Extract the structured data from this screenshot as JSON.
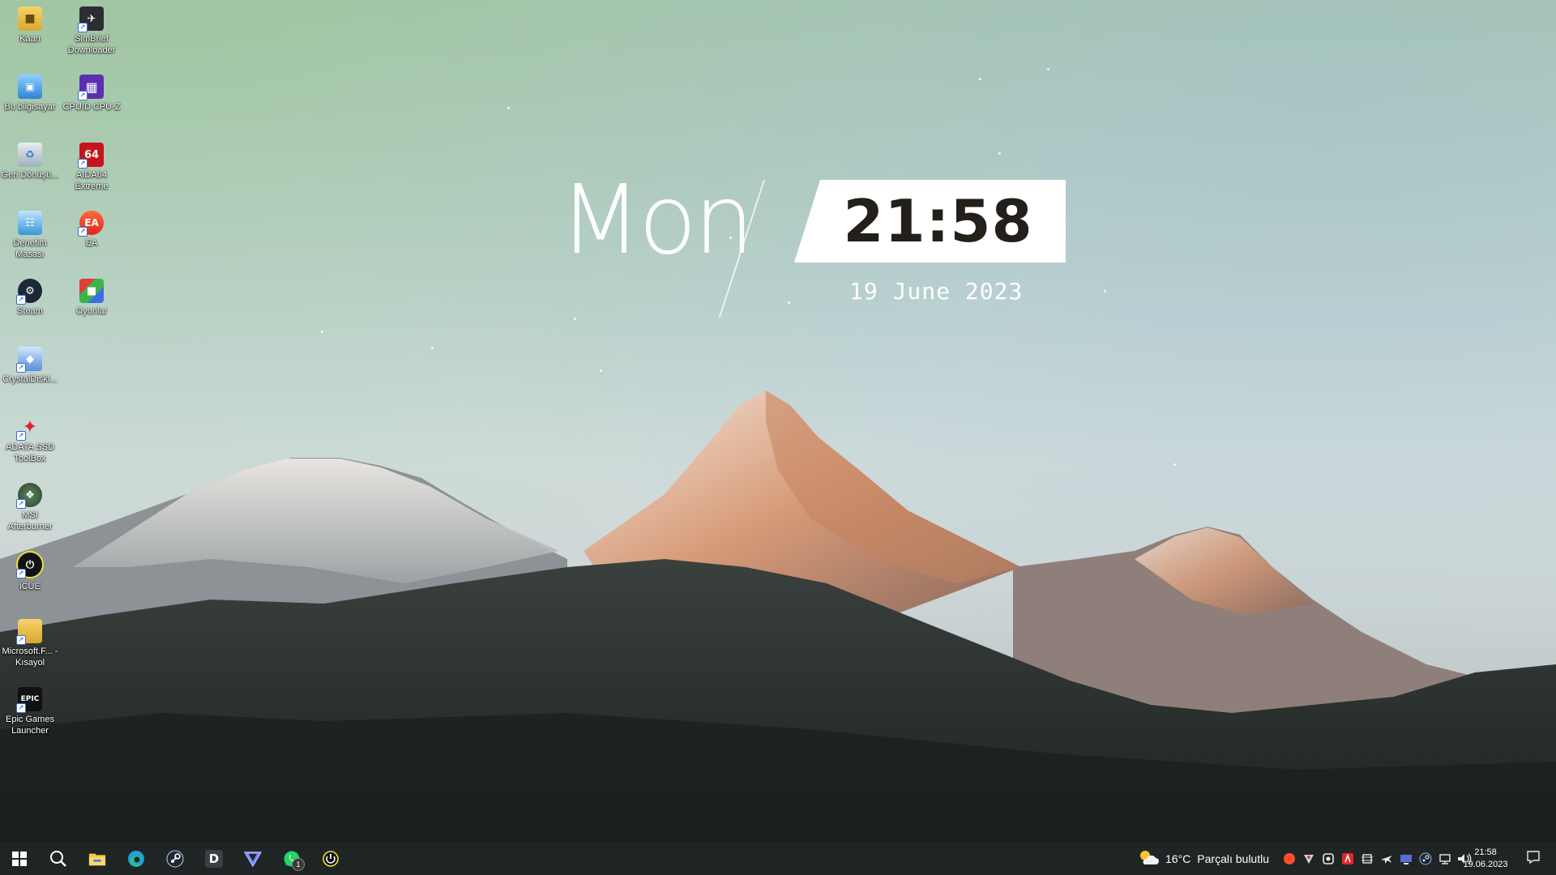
{
  "desktop": {
    "icons": [
      {
        "label": "Kaan"
      },
      {
        "label": "SimBrief Downloader"
      },
      {
        "label": "Bu bilgisayar"
      },
      {
        "label": "CPUID CPU-Z"
      },
      {
        "label": "Geri Dönüşü..."
      },
      {
        "label": "AIDA64 Extreme"
      },
      {
        "label": "Denetim Masası"
      },
      {
        "label": "EA"
      },
      {
        "label": "Steam"
      },
      {
        "label": "Oyunlar"
      },
      {
        "label": "CrystalDiskI..."
      },
      {
        "label": "ADATA SSD ToolBox"
      },
      {
        "label": "MSI Afterburner"
      },
      {
        "label": "iCUE"
      },
      {
        "label": "Microsoft.F... - Kısayol"
      },
      {
        "label": "Epic Games Launcher"
      }
    ]
  },
  "widget": {
    "day": "Mon",
    "time": "21:58",
    "date": "19 June 2023"
  },
  "taskbar": {
    "pinned": [
      {
        "name": "windows-start-icon"
      },
      {
        "name": "search-icon"
      },
      {
        "name": "file-explorer-icon"
      },
      {
        "name": "edge-icon"
      },
      {
        "name": "steam-icon"
      },
      {
        "name": "discord-d-icon"
      },
      {
        "name": "vpn-triangle-icon"
      },
      {
        "name": "whatsapp-icon",
        "badge": "1"
      },
      {
        "name": "icue-icon"
      }
    ],
    "weather": {
      "temp": "16°C",
      "condition": "Parçalı bulutlu"
    },
    "clock": {
      "time": "21:58",
      "date": "19.06.2023"
    }
  },
  "colors": {
    "taskbar": "#1f2425",
    "clock_text": "#231f1a"
  }
}
